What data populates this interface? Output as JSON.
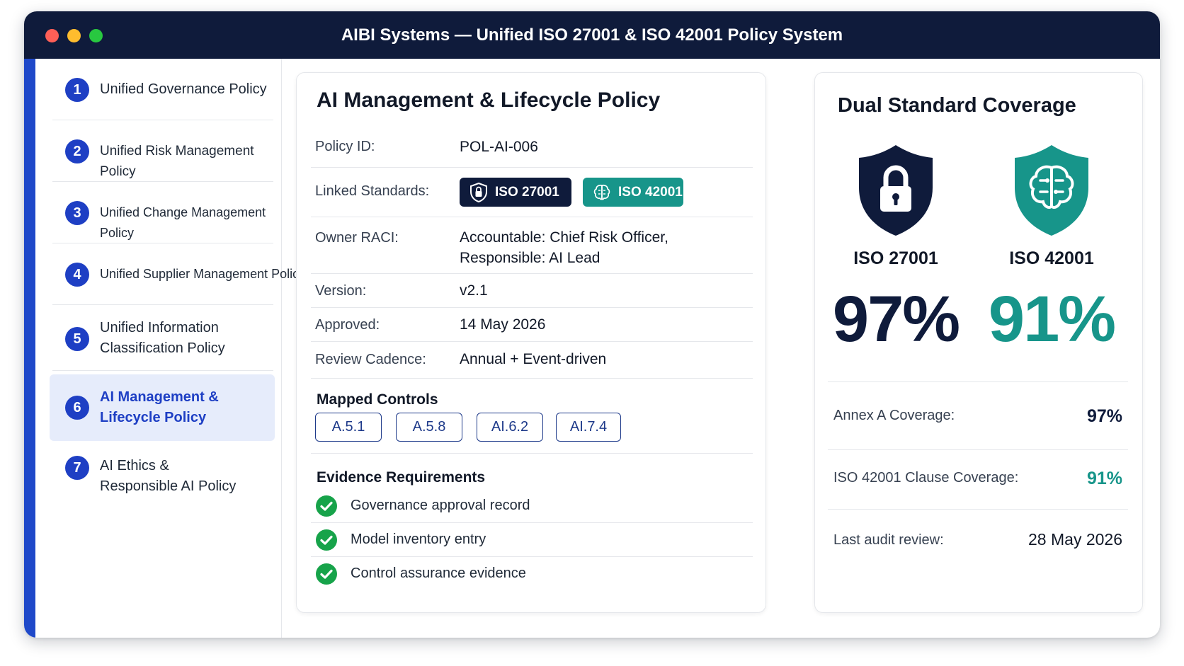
{
  "window": {
    "title": "AIBI Systems — Unified ISO 27001 & ISO 42001 Policy System"
  },
  "sidebar": {
    "items": [
      {
        "num": "1",
        "label": "Unified Governance Policy"
      },
      {
        "num": "2",
        "label": "Unified Risk Management Policy"
      },
      {
        "num": "3",
        "label": "Unified Change Management Policy"
      },
      {
        "num": "4",
        "label": "Unified Supplier Management Policy"
      },
      {
        "num": "5",
        "label": "Unified Information Classification Policy"
      },
      {
        "num": "6",
        "label": "AI Management & Lifecycle Policy"
      },
      {
        "num": "7",
        "label": "AI Ethics & Responsible AI Policy"
      }
    ],
    "active_index": 5
  },
  "policy": {
    "title": "AI Management & Lifecycle Policy",
    "fields": {
      "policy_id_label": "Policy ID:",
      "policy_id": "POL-AI-006",
      "linked_label": "Linked Standards:",
      "linked": [
        {
          "label": "ISO 27001",
          "icon": "shield-lock-icon",
          "color": "#0f1b3b"
        },
        {
          "label": "ISO 42001",
          "icon": "brain-icon",
          "color": "#17958a"
        }
      ],
      "owner_label": "Owner RACI:",
      "owner_line1": "Accountable: Chief Risk Officer,",
      "owner_line2": "Responsible: AI Lead",
      "version_label": "Version:",
      "version": "v2.1",
      "approved_label": "Approved:",
      "approved": "14 May 2026",
      "cadence_label": "Review Cadence:",
      "cadence": "Annual + Event-driven"
    },
    "mapped_controls_heading": "Mapped Controls",
    "mapped_controls": [
      "A.5.1",
      "A.5.8",
      "AI.6.2",
      "AI.7.4"
    ],
    "evidence_heading": "Evidence Requirements",
    "evidence": [
      "Governance approval record",
      "Model inventory entry",
      "Control assurance evidence"
    ]
  },
  "coverage": {
    "title": "Dual Standard Coverage",
    "standards": [
      {
        "name": "ISO 27001",
        "percent": "97%",
        "icon": "shield-lock-icon",
        "color": "#0f1b3b"
      },
      {
        "name": "ISO 42001",
        "percent": "91%",
        "icon": "shield-brain-icon",
        "color": "#17958a"
      }
    ],
    "annex_label": "Annex A Coverage:",
    "annex_value": "97%",
    "clause_label": "ISO 42001 Clause Coverage:",
    "clause_value": "91%",
    "audit_label": "Last audit review:",
    "audit_value": "28 May 2026"
  }
}
